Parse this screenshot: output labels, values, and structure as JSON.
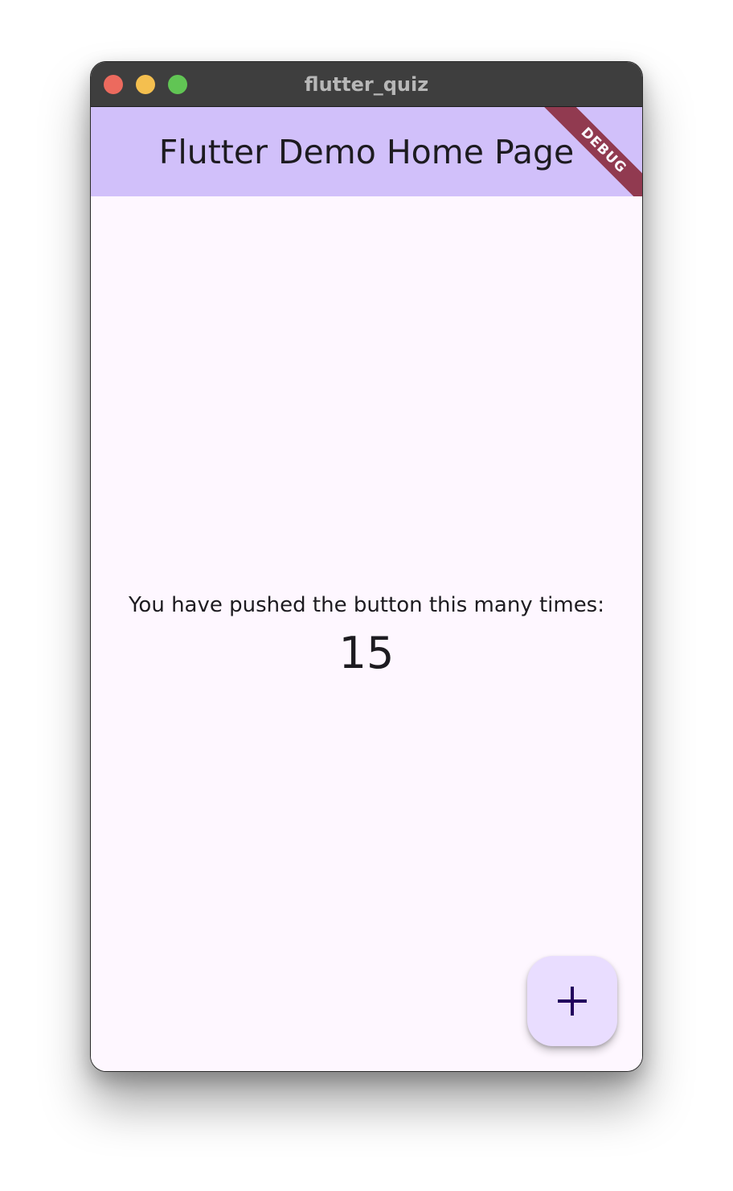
{
  "window": {
    "title": "flutter_quiz"
  },
  "appbar": {
    "title": "Flutter Demo Home Page"
  },
  "debug_banner": {
    "label": "DEBUG"
  },
  "body": {
    "message": "You have pushed the button this many times:",
    "counter": "15"
  },
  "fab": {
    "icon": "plus-icon"
  },
  "colors": {
    "appbar_bg": "#d1c0fa",
    "surface": "#fef7ff",
    "fab_bg": "#e9ddff",
    "fab_icon": "#21005d",
    "debug_banner": "#8b2c3e"
  }
}
